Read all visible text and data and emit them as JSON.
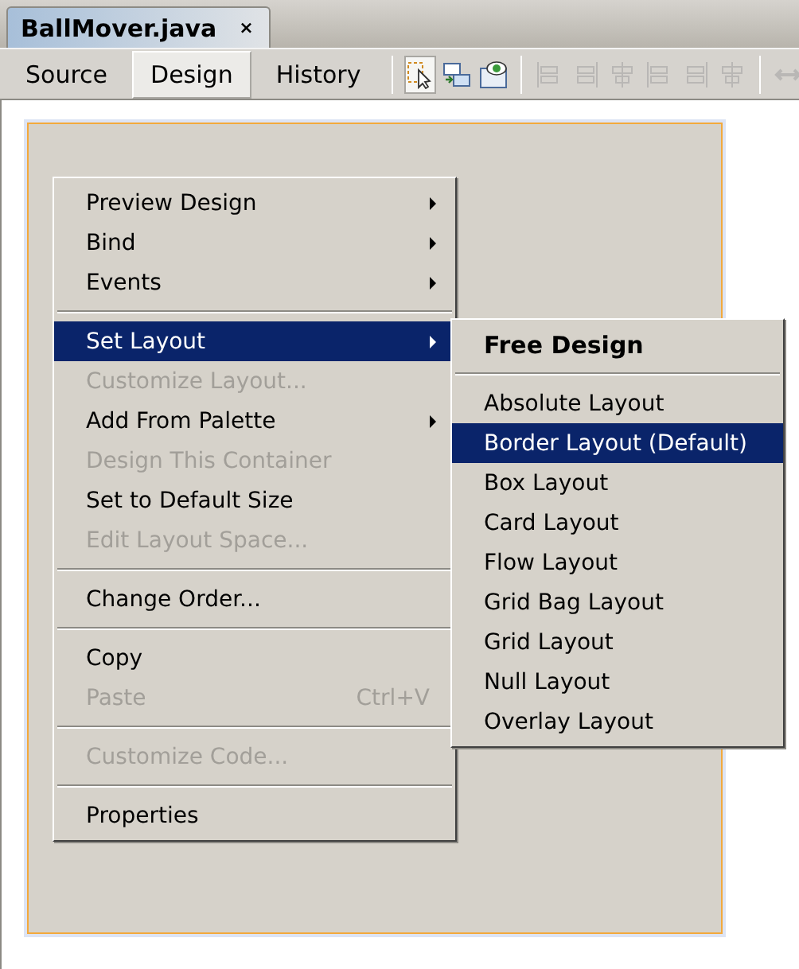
{
  "file_tab": {
    "title": "BallMover.java",
    "close": "×",
    "selected": true
  },
  "view_tabs": [
    {
      "label": "Source",
      "selected": false
    },
    {
      "label": "Design",
      "selected": true
    },
    {
      "label": "History",
      "selected": false
    }
  ],
  "toolbar": [
    {
      "kind": "select",
      "selected": true,
      "disabled": false
    },
    {
      "kind": "connect",
      "selected": false,
      "disabled": false
    },
    {
      "kind": "preview",
      "selected": false,
      "disabled": false
    },
    {
      "kind": "separator"
    },
    {
      "kind": "align-left",
      "selected": false,
      "disabled": true
    },
    {
      "kind": "align-right",
      "selected": false,
      "disabled": true
    },
    {
      "kind": "center-h",
      "selected": false,
      "disabled": true
    },
    {
      "kind": "align-top",
      "selected": false,
      "disabled": true
    },
    {
      "kind": "align-bottom",
      "selected": false,
      "disabled": true
    },
    {
      "kind": "center-v",
      "selected": false,
      "disabled": true
    },
    {
      "kind": "separator"
    },
    {
      "kind": "resize",
      "selected": false,
      "disabled": true
    }
  ],
  "context_menu": [
    {
      "kind": "item",
      "label": "Preview Design",
      "submenu": true,
      "disabled": false,
      "selected": false
    },
    {
      "kind": "item",
      "label": "Bind",
      "submenu": true,
      "disabled": false,
      "selected": false
    },
    {
      "kind": "item",
      "label": "Events",
      "submenu": true,
      "disabled": false,
      "selected": false
    },
    {
      "kind": "separator"
    },
    {
      "kind": "item",
      "label": "Set Layout",
      "submenu": true,
      "disabled": false,
      "selected": true
    },
    {
      "kind": "item",
      "label": "Customize Layout...",
      "submenu": false,
      "disabled": true,
      "selected": false
    },
    {
      "kind": "item",
      "label": "Add From Palette",
      "submenu": true,
      "disabled": false,
      "selected": false
    },
    {
      "kind": "item",
      "label": "Design This Container",
      "submenu": false,
      "disabled": true,
      "selected": false
    },
    {
      "kind": "item",
      "label": "Set to Default Size",
      "submenu": false,
      "disabled": false,
      "selected": false
    },
    {
      "kind": "item",
      "label": "Edit Layout Space...",
      "submenu": false,
      "disabled": true,
      "selected": false
    },
    {
      "kind": "separator"
    },
    {
      "kind": "item",
      "label": "Change Order...",
      "submenu": false,
      "disabled": false,
      "selected": false
    },
    {
      "kind": "separator"
    },
    {
      "kind": "item",
      "label": "Copy",
      "submenu": false,
      "disabled": false,
      "selected": false
    },
    {
      "kind": "item",
      "label": "Paste",
      "shortcut": "Ctrl+V",
      "submenu": false,
      "disabled": true,
      "selected": false
    },
    {
      "kind": "separator"
    },
    {
      "kind": "item",
      "label": "Customize Code...",
      "submenu": false,
      "disabled": true,
      "selected": false
    },
    {
      "kind": "separator"
    },
    {
      "kind": "item",
      "label": "Properties",
      "submenu": false,
      "disabled": false,
      "selected": false
    }
  ],
  "layout_submenu": [
    {
      "kind": "header",
      "label": "Free Design",
      "selected": false
    },
    {
      "kind": "separator"
    },
    {
      "kind": "item",
      "label": "Absolute Layout",
      "selected": false
    },
    {
      "kind": "item",
      "label": "Border Layout (Default)",
      "selected": true
    },
    {
      "kind": "item",
      "label": "Box Layout",
      "selected": false
    },
    {
      "kind": "item",
      "label": "Card Layout",
      "selected": false
    },
    {
      "kind": "item",
      "label": "Flow Layout",
      "selected": false
    },
    {
      "kind": "item",
      "label": "Grid Bag Layout",
      "selected": false
    },
    {
      "kind": "item",
      "label": "Grid Layout",
      "selected": false
    },
    {
      "kind": "item",
      "label": "Null Layout",
      "selected": false
    },
    {
      "kind": "item",
      "label": "Overlay Layout",
      "selected": false
    }
  ]
}
